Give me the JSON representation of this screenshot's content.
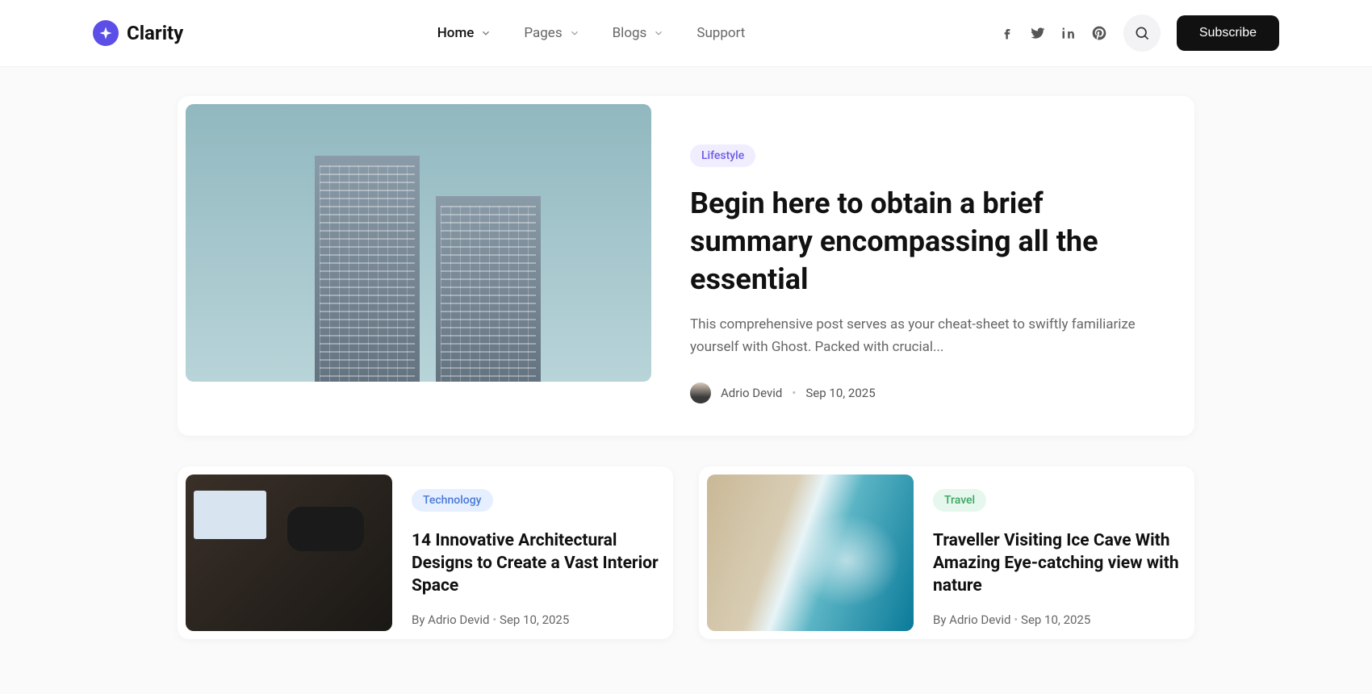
{
  "brand": {
    "name": "Clarity"
  },
  "nav": {
    "home": "Home",
    "pages": "Pages",
    "blogs": "Blogs",
    "support": "Support"
  },
  "header": {
    "subscribe": "Subscribe"
  },
  "featured": {
    "tag": "Lifestyle",
    "title": "Begin here to obtain a brief summary encompassing all the essential",
    "desc": "This comprehensive post serves as your cheat-sheet to swiftly familiarize yourself with Ghost. Packed with crucial...",
    "author": "Adrio Devid",
    "date": "Sep 10, 2025"
  },
  "cards": [
    {
      "tag": "Technology",
      "title": "14 Innovative Architectural Designs to Create a Vast Interior Space",
      "by": "By Adrio Devid",
      "date": "Sep 10, 2025"
    },
    {
      "tag": "Travel",
      "title": "Traveller Visiting Ice Cave With Amazing Eye-catching view with nature",
      "by": "By Adrio Devid",
      "date": "Sep 10, 2025"
    }
  ]
}
